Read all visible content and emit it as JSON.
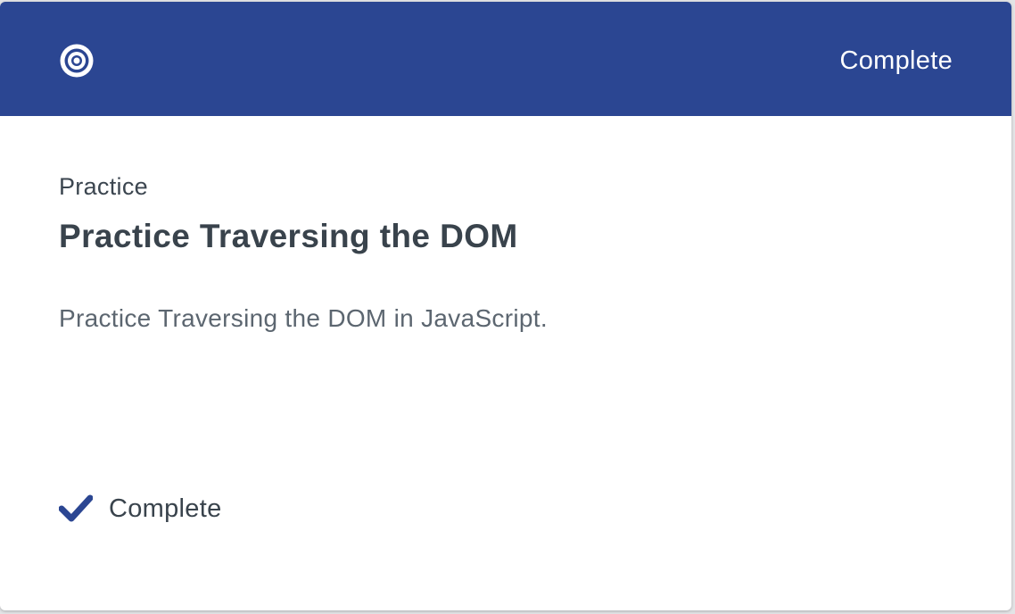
{
  "colors": {
    "header_background": "#2b4692",
    "accent": "#2b4692",
    "title_text": "#39434c",
    "description_text": "#5c6670"
  },
  "header": {
    "icon": "target-icon",
    "status": "Complete"
  },
  "content": {
    "kind": "Practice",
    "title": "Practice Traversing the DOM",
    "description": "Practice Traversing the DOM in JavaScript."
  },
  "footer": {
    "icon": "checkmark-icon",
    "status": "Complete"
  }
}
